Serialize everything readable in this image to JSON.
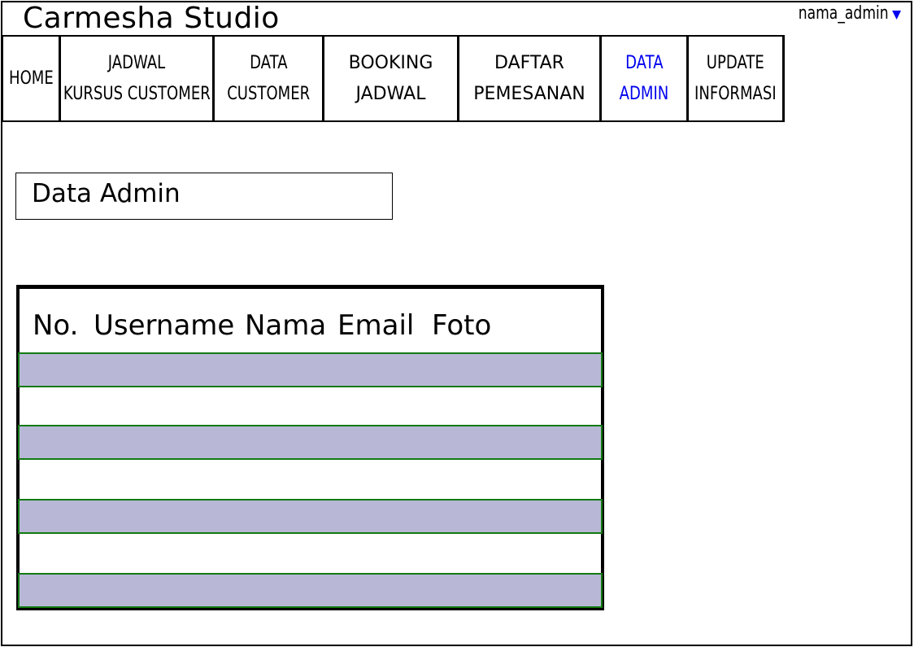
{
  "app": {
    "title": "Carmesha Studio"
  },
  "user": {
    "name": "nama_admin",
    "menu_icon": "caret-down-icon"
  },
  "nav": {
    "items": [
      {
        "lines": [
          "HOME"
        ]
      },
      {
        "lines": [
          "JADWAL",
          "KURSUS CUSTOMER"
        ]
      },
      {
        "lines": [
          "DATA",
          "CUSTOMER"
        ]
      },
      {
        "lines": [
          "BOOKING",
          "JADWAL"
        ]
      },
      {
        "lines": [
          "DAFTAR",
          "PEMESANAN"
        ]
      },
      {
        "lines": [
          "DATA",
          "ADMIN"
        ],
        "active": true
      },
      {
        "lines": [
          "UPDATE",
          "INFORMASI"
        ]
      }
    ],
    "active_color": "#0000ee"
  },
  "page": {
    "title": "Data Admin"
  },
  "table": {
    "headers": [
      "No.",
      "Username",
      "Nama",
      "Email",
      "Foto"
    ],
    "row_fill": "#b8b8d6",
    "row_border": "#127a12"
  }
}
